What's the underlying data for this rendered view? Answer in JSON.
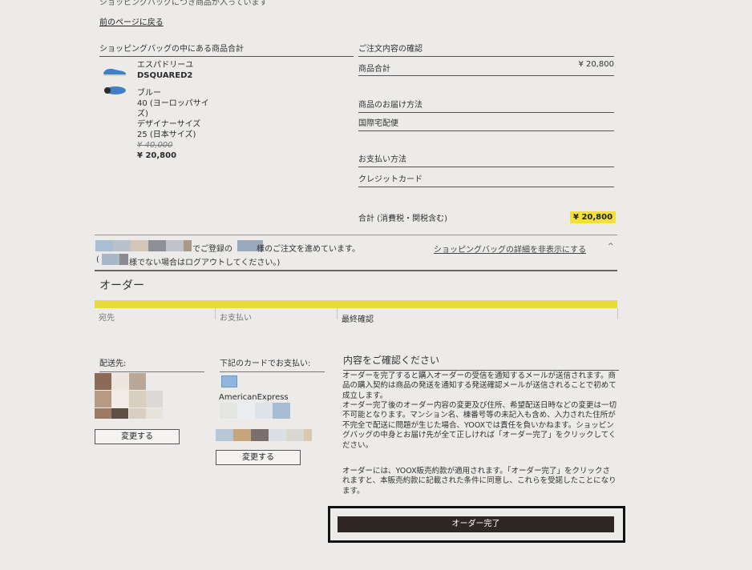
{
  "top_cut_text": "ショッピングバッグにつき商品が入っています",
  "back_link": "前のページに戻る",
  "bag": {
    "title": "ショッピングバッグの中にある商品合計",
    "product": {
      "name": "エスパドリーユ",
      "brand": "DSQUARED2",
      "color": "ブルー",
      "size_eu": "40 (ヨーロッパサイズ)",
      "size_designer_label": "デザイナーサイズ",
      "size_jp": "25 (日本サイズ)",
      "original_price": "¥ 40,000",
      "sale_price": "¥ 20,800"
    }
  },
  "summary": {
    "title": "ご注文内容の確認",
    "subtotal_label": "商品合計",
    "subtotal_value": "¥ 20,800",
    "delivery_title": "商品のお届け方法",
    "delivery_value": "国際宅配便",
    "payment_title": "お支払い方法",
    "payment_value": "クレジットカード",
    "total_label": "合計 (消費税・関税含む)",
    "total_value": "¥ 20,800"
  },
  "login": {
    "line1": "でご登録の　　　様のご注文を進めています。",
    "line2_prefix": "(",
    "line2": "様でない場合はログアウトしてください。)",
    "hide_link": "ショッピングバッグの詳細を非表示にする",
    "hide_arrow": "^"
  },
  "order": {
    "heading": "オーダー",
    "steps": [
      "宛先",
      "お支払い",
      "最終確認"
    ],
    "shipping_title": "配送先:",
    "card_title": "下記のカードでお支払い:",
    "card_brand": "AmericanExpress",
    "change_label": "変更する",
    "change_label_2": "変更する",
    "confirm_title": "内容をご確認ください",
    "para1": "オーダーを完了すると購入オーダーの受信を通知するメールが送信されます。商品の購入契約は商品の発送を通知する発送確認メールが送信されることで初めて成立します。",
    "para2": "オーダー完了後のオーダー内容の変更及び住所、希望配送日時などの変更は一切不可能となります。マンション名、棟番号等の未記入も含め、入力された住所が不完全で配送に問題が生じた場合、YOOXでは責任を負いかねます。ショッピングバッグの中身とお届け先が全て正しければ「オーダー完了」をクリックしてください。",
    "para3": "オーダーには、YOOX販売約款が適用されます。「オーダー完了」をクリックされますと、本販売約款に記載された条件に同意し、これらを受諾したことになります。",
    "complete_label": "オーダー完了"
  },
  "colors": {
    "accent_yellow": "#e7dc3b",
    "button_dark": "#2f2724",
    "shoe_blue": "#3f7fc6"
  }
}
